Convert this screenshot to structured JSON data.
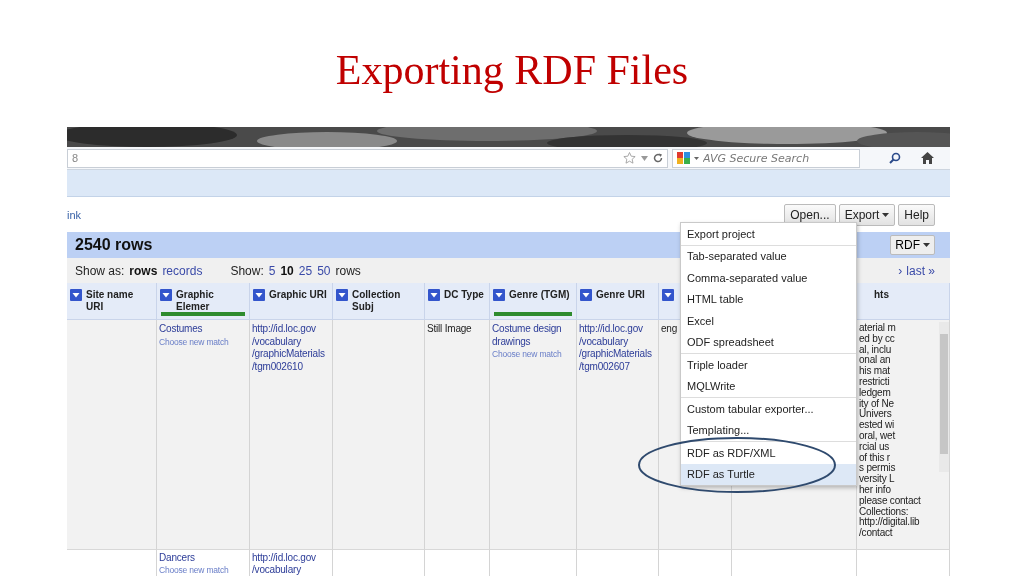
{
  "slide_title": "Exporting RDF Files",
  "browser": {
    "url": "8",
    "search_placeholder": "AVG Secure Search"
  },
  "app": {
    "left_link": "ink",
    "buttons": [
      {
        "label": "Open...",
        "caret": false
      },
      {
        "label": "Export",
        "caret": true
      },
      {
        "label": "Help",
        "caret": false
      }
    ]
  },
  "grid_header": {
    "row_count": "2540 rows",
    "rdf_button": "RDF"
  },
  "view_bar": {
    "show_as_label": "Show as:",
    "show_as": [
      {
        "label": "rows",
        "selected": true
      },
      {
        "label": "records",
        "selected": false
      }
    ],
    "show_label": "Show:",
    "page_sizes": [
      {
        "label": "5",
        "selected": false
      },
      {
        "label": "10",
        "selected": true
      },
      {
        "label": "25",
        "selected": false
      },
      {
        "label": "50",
        "selected": false
      }
    ],
    "rows_word": "rows",
    "pager": [
      "›",
      "last »"
    ]
  },
  "columns": [
    {
      "kind": "data",
      "label": "Site name URI",
      "matched": false
    },
    {
      "kind": "data",
      "label": "Graphic Elemer",
      "matched": true
    },
    {
      "kind": "data",
      "label": "Graphic URI",
      "matched": false
    },
    {
      "kind": "data",
      "label": "Collection Subj",
      "matched": false
    },
    {
      "kind": "data",
      "label": "DC Type",
      "matched": false
    },
    {
      "kind": "data",
      "label": "Genre (TGM)",
      "matched": true
    },
    {
      "kind": "data",
      "label": "Genre URI",
      "matched": false
    },
    {
      "kind": "arrow",
      "matched": false
    },
    {
      "kind": "blank"
    },
    {
      "kind": "data",
      "label": "hts",
      "matched": false,
      "no_arrow": true
    }
  ],
  "rows": [
    {
      "cells": [
        {
          "kind": "empty"
        },
        {
          "kind": "link",
          "text": "Costumes",
          "match_link": "Choose new match"
        },
        {
          "kind": "link",
          "text": "http://id.loc.gov\n/vocabulary\n/graphicMaterials\n/tgm002610"
        },
        {
          "kind": "empty"
        },
        {
          "kind": "plain",
          "text": "Still Image"
        },
        {
          "kind": "link",
          "text": "Costume design\ndrawings",
          "match_link": "Choose new match"
        },
        {
          "kind": "link",
          "text": "http://id.loc.gov\n/vocabulary\n/graphicMaterials\n/tgm002607"
        },
        {
          "kind": "plain",
          "text": "eng"
        },
        {
          "kind": "empty"
        },
        {
          "kind": "scroll",
          "text": "aterial m\ned by cc\nal, inclu\nonal an\nhis mat\nrestricti\nledgem\nity of Ne\nUnivers\nested wi\noral, wet\nrcial us\nof this r\ns permis\nversity L\nher info\nplease contact\nCollections:\nhttp://digital.lib\n/contact"
        }
      ]
    },
    {
      "cells": [
        {
          "kind": "empty"
        },
        {
          "kind": "link",
          "text": "Dancers",
          "match_link": "Choose new match"
        },
        {
          "kind": "link",
          "text": "http://id.loc.gov\n/vocabulary"
        },
        {
          "kind": "empty"
        },
        {
          "kind": "empty"
        },
        {
          "kind": "empty"
        },
        {
          "kind": "empty"
        },
        {
          "kind": "empty"
        },
        {
          "kind": "empty"
        },
        {
          "kind": "empty"
        }
      ]
    }
  ],
  "export_menu": {
    "groups": [
      [
        {
          "label": "Export project",
          "selected": false
        }
      ],
      [
        {
          "label": "Tab-separated value",
          "selected": false
        },
        {
          "label": "Comma-separated value",
          "selected": false
        },
        {
          "label": "HTML table",
          "selected": false
        },
        {
          "label": "Excel",
          "selected": false
        },
        {
          "label": "ODF spreadsheet",
          "selected": false
        }
      ],
      [
        {
          "label": "Triple loader",
          "selected": false
        },
        {
          "label": "MQLWrite",
          "selected": false
        }
      ],
      [
        {
          "label": "Custom tabular exporter...",
          "selected": false
        },
        {
          "label": "Templating...",
          "selected": false
        }
      ],
      [
        {
          "label": "RDF as RDF/XML",
          "selected": false
        },
        {
          "label": "RDF as Turtle",
          "selected": true
        }
      ]
    ]
  }
}
